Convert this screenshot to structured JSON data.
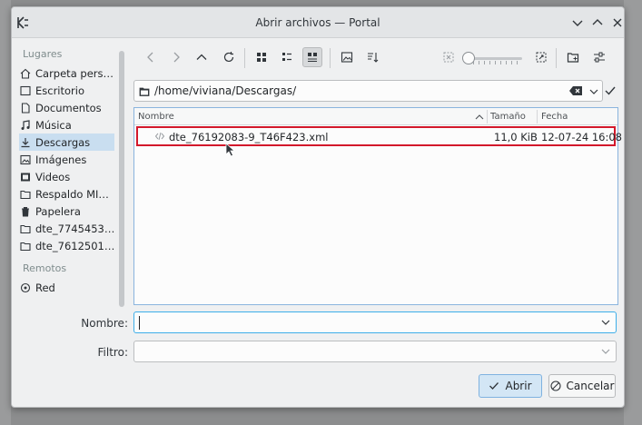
{
  "window": {
    "title": "Abrir archivos — Portal"
  },
  "sidebar": {
    "sections": [
      {
        "title": "Lugares"
      },
      {
        "title": "Remotos"
      }
    ],
    "places": [
      {
        "label": "Carpeta pers…",
        "icon": "home-icon",
        "active": false
      },
      {
        "label": "Escritorio",
        "icon": "desktop-icon",
        "active": false
      },
      {
        "label": "Documentos",
        "icon": "document-icon",
        "active": false
      },
      {
        "label": "Música",
        "icon": "music-icon",
        "active": false
      },
      {
        "label": "Descargas",
        "icon": "download-icon",
        "active": true
      },
      {
        "label": "Imágenes",
        "icon": "image-icon",
        "active": false
      },
      {
        "label": "Videos",
        "icon": "video-icon",
        "active": false
      },
      {
        "label": "Respaldo MI…",
        "icon": "folder-icon",
        "active": false
      },
      {
        "label": "Papelera",
        "icon": "trash-icon",
        "active": false
      },
      {
        "label": "dte_7745453…",
        "icon": "folder-icon",
        "active": false
      },
      {
        "label": "dte_7612501…",
        "icon": "folder-icon",
        "active": false
      }
    ],
    "remotes": [
      {
        "label": "Red",
        "icon": "network-icon"
      }
    ]
  },
  "path": {
    "value": "/home/viviana/Descargas/"
  },
  "filelist": {
    "columns": [
      "Nombre",
      "Tamaño",
      "Fecha"
    ],
    "rows": [
      {
        "name": "dte_76192083-9_T46F423.xml",
        "size": "11,0 KiB",
        "date": "12-07-24 16:08"
      }
    ]
  },
  "form": {
    "name_label": "Nombre:",
    "name_value": "",
    "filter_label": "Filtro:",
    "filter_value": ""
  },
  "buttons": {
    "open": "Abrir",
    "cancel": "Cancelar"
  },
  "colors": {
    "accent": "#3daee9",
    "highlight": "#d3182b",
    "selected_place": "#c9def0"
  }
}
